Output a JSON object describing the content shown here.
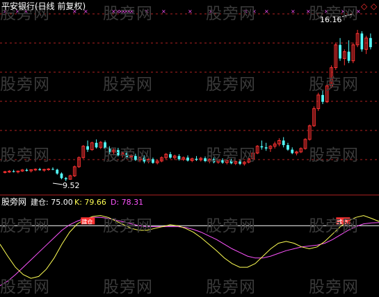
{
  "price_panel": {
    "title": "平安银行(日线 前复权)",
    "high_label": "16.16",
    "low_label": "9.52"
  },
  "indicator_panel": {
    "name": "股旁网",
    "line1_label": "建仓: 75.00",
    "line2_label": "K: 79.66",
    "line3_label": "D: 78.31",
    "signal_text": "建仓"
  },
  "watermark": "股旁网",
  "colors": {
    "background": "#000000",
    "up_candle": "#ff3232",
    "down_candle": "#54ffff",
    "grid": "#b22222",
    "title": "#ffffff",
    "k_line": "#ffff54",
    "d_line": "#ff54ff",
    "build_line": "#ffffff",
    "marker": "#ff54ff"
  },
  "chart_data": {
    "type": "candlestick",
    "candles": [
      [
        9.9,
        9.97,
        9.85,
        9.93
      ],
      [
        9.93,
        10.0,
        9.88,
        9.95
      ],
      [
        9.95,
        10.02,
        9.9,
        9.92
      ],
      [
        9.92,
        9.98,
        9.86,
        9.96
      ],
      [
        9.96,
        10.05,
        9.92,
        10.01
      ],
      [
        10.01,
        10.07,
        9.94,
        9.97
      ],
      [
        9.97,
        10.03,
        9.9,
        10.02
      ],
      [
        10.02,
        10.08,
        9.96,
        10.04
      ],
      [
        10.04,
        10.1,
        9.98,
        10.0
      ],
      [
        10.0,
        10.06,
        9.93,
        10.03
      ],
      [
        10.03,
        10.09,
        9.97,
        10.05
      ],
      [
        10.05,
        10.12,
        10.0,
        10.02
      ],
      [
        10.02,
        10.06,
        9.8,
        9.85
      ],
      [
        9.85,
        9.9,
        9.6,
        9.65
      ],
      [
        9.65,
        9.7,
        9.52,
        9.6
      ],
      [
        9.6,
        9.8,
        9.58,
        9.75
      ],
      [
        9.75,
        10.2,
        9.7,
        10.15
      ],
      [
        10.15,
        10.6,
        10.1,
        10.55
      ],
      [
        10.55,
        11.1,
        10.5,
        11.05
      ],
      [
        11.05,
        11.3,
        10.8,
        10.9
      ],
      [
        10.9,
        11.25,
        10.85,
        11.2
      ],
      [
        11.2,
        11.35,
        10.95,
        11.0
      ],
      [
        11.0,
        11.28,
        10.92,
        11.22
      ],
      [
        11.22,
        11.3,
        10.9,
        10.95
      ],
      [
        10.95,
        11.05,
        10.7,
        10.8
      ],
      [
        10.8,
        10.95,
        10.65,
        10.88
      ],
      [
        10.88,
        10.98,
        10.6,
        10.65
      ],
      [
        10.65,
        10.8,
        10.55,
        10.75
      ],
      [
        10.75,
        10.85,
        10.5,
        10.58
      ],
      [
        10.58,
        10.7,
        10.45,
        10.62
      ],
      [
        10.62,
        10.72,
        10.4,
        10.45
      ],
      [
        10.45,
        10.6,
        10.35,
        10.55
      ],
      [
        10.55,
        10.65,
        10.3,
        10.38
      ],
      [
        10.38,
        10.52,
        10.3,
        10.48
      ],
      [
        10.48,
        10.55,
        10.28,
        10.32
      ],
      [
        10.32,
        10.45,
        10.25,
        10.4
      ],
      [
        10.4,
        10.6,
        10.35,
        10.55
      ],
      [
        10.55,
        10.75,
        10.48,
        10.7
      ],
      [
        10.7,
        10.8,
        10.5,
        10.55
      ],
      [
        10.55,
        10.68,
        10.45,
        10.62
      ],
      [
        10.62,
        10.7,
        10.42,
        10.48
      ],
      [
        10.48,
        10.6,
        10.4,
        10.55
      ],
      [
        10.55,
        10.65,
        10.38,
        10.42
      ],
      [
        10.42,
        10.55,
        10.35,
        10.5
      ],
      [
        10.5,
        10.62,
        10.4,
        10.45
      ],
      [
        10.45,
        10.58,
        10.38,
        10.52
      ],
      [
        10.52,
        10.6,
        10.35,
        10.4
      ],
      [
        10.4,
        10.52,
        10.3,
        10.48
      ],
      [
        10.48,
        10.56,
        10.3,
        10.35
      ],
      [
        10.35,
        10.48,
        10.28,
        10.44
      ],
      [
        10.44,
        10.52,
        10.28,
        10.33
      ],
      [
        10.33,
        10.45,
        10.25,
        10.42
      ],
      [
        10.42,
        10.5,
        10.26,
        10.3
      ],
      [
        10.3,
        10.42,
        10.22,
        10.38
      ],
      [
        10.38,
        10.46,
        10.22,
        10.28
      ],
      [
        10.28,
        10.4,
        10.2,
        10.35
      ],
      [
        10.35,
        10.55,
        10.3,
        10.5
      ],
      [
        10.5,
        10.8,
        10.45,
        10.75
      ],
      [
        10.75,
        11.1,
        10.7,
        11.05
      ],
      [
        11.05,
        11.3,
        10.9,
        11.0
      ],
      [
        11.0,
        11.2,
        10.85,
        10.95
      ],
      [
        10.95,
        11.1,
        10.8,
        11.05
      ],
      [
        11.05,
        11.25,
        10.95,
        11.15
      ],
      [
        11.15,
        11.4,
        11.05,
        11.3
      ],
      [
        11.3,
        11.45,
        11.0,
        11.1
      ],
      [
        11.1,
        11.2,
        10.85,
        10.9
      ],
      [
        10.9,
        11.0,
        10.7,
        10.75
      ],
      [
        10.75,
        10.85,
        10.65,
        10.8
      ],
      [
        10.8,
        11.0,
        10.75,
        10.95
      ],
      [
        10.95,
        11.4,
        10.9,
        11.35
      ],
      [
        11.35,
        12.0,
        11.3,
        11.95
      ],
      [
        11.95,
        12.8,
        11.9,
        12.7
      ],
      [
        12.7,
        13.4,
        12.6,
        13.3
      ],
      [
        13.3,
        13.5,
        12.9,
        13.0
      ],
      [
        13.0,
        13.8,
        12.95,
        13.7
      ],
      [
        13.7,
        14.6,
        13.6,
        14.5
      ],
      [
        14.5,
        15.6,
        14.4,
        15.5
      ],
      [
        15.5,
        15.8,
        14.8,
        14.9
      ],
      [
        14.9,
        15.3,
        14.6,
        15.2
      ],
      [
        15.2,
        15.7,
        14.7,
        14.8
      ],
      [
        14.8,
        15.6,
        14.7,
        15.5
      ],
      [
        15.5,
        16.16,
        15.4,
        16.0
      ],
      [
        16.0,
        16.1,
        15.2,
        15.3
      ],
      [
        15.3,
        15.9,
        15.1,
        15.8
      ],
      [
        15.8,
        16.0,
        15.3,
        15.4
      ]
    ],
    "indicator": {
      "build_level": 75.0,
      "ylim": [
        0,
        100
      ],
      "k": [
        55,
        42,
        30,
        22,
        18,
        20,
        28,
        40,
        55,
        68,
        77,
        82,
        85,
        86,
        84,
        80,
        76,
        72,
        70,
        70,
        72,
        74,
        76,
        75,
        72,
        68,
        62,
        55,
        48,
        40,
        34,
        30,
        30,
        34,
        42,
        50,
        56,
        58,
        56,
        52,
        50,
        52,
        58,
        66,
        74,
        80,
        84,
        86,
        83,
        79.66
      ],
      "d": [
        10,
        15,
        22,
        30,
        38,
        46,
        54,
        62,
        70,
        76,
        80,
        83,
        84,
        84,
        83,
        81,
        79,
        77,
        75,
        74,
        74,
        74,
        74,
        74,
        73,
        71,
        68,
        64,
        60,
        55,
        50,
        46,
        42,
        40,
        40,
        42,
        45,
        48,
        50,
        52,
        53,
        54,
        56,
        60,
        65,
        70,
        74,
        77,
        78,
        78.31
      ],
      "signals": [
        11,
        44
      ]
    },
    "ylim": [
      9.0,
      16.8
    ]
  }
}
